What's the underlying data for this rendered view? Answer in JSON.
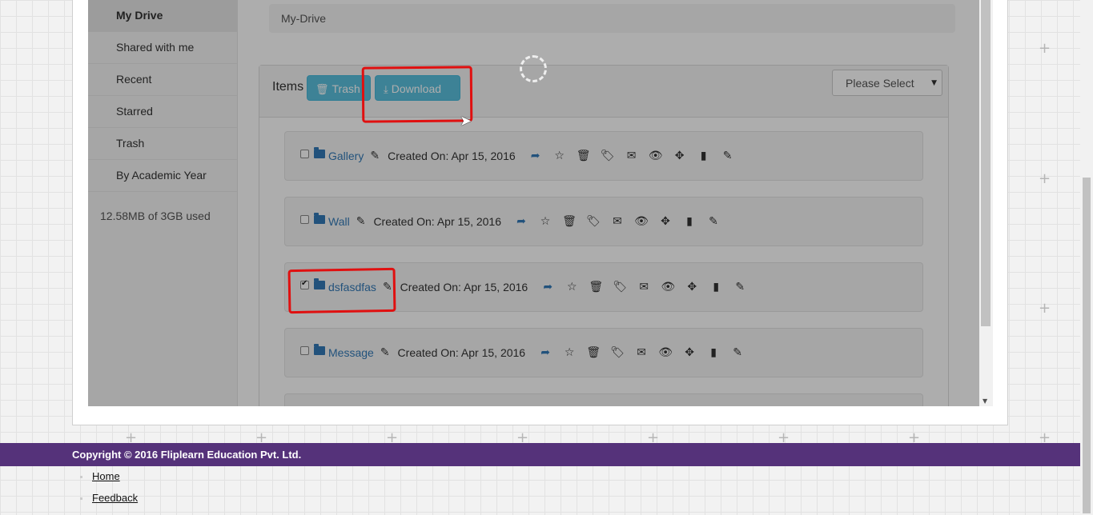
{
  "sidebar": {
    "items": [
      {
        "label": "My Drive"
      },
      {
        "label": "Shared with me"
      },
      {
        "label": "Recent"
      },
      {
        "label": "Starred"
      },
      {
        "label": "Trash"
      },
      {
        "label": "By Academic Year"
      }
    ],
    "active": "My Drive",
    "storage": "12.58MB of 3GB used"
  },
  "breadcrumb": "My-Drive",
  "panel": {
    "items_label": "Items",
    "trash_button": "Trash",
    "download_button": "Download",
    "select_value": "Please Select"
  },
  "rows": [
    {
      "name": "Gallery",
      "created": "Created On: Apr 15, 2016",
      "checked": false
    },
    {
      "name": "Wall",
      "created": "Created On: Apr 15, 2016",
      "checked": false
    },
    {
      "name": "dsfasdfas",
      "created": "Created On: Apr 15, 2016",
      "checked": true
    },
    {
      "name": "Message",
      "created": "Created On: Apr 15, 2016",
      "checked": false
    }
  ],
  "row_actions": [
    "share-icon",
    "star-icon",
    "trash-icon",
    "tags-icon",
    "envelope-icon",
    "eye-icon",
    "move-icon",
    "copy-icon",
    "edit-icon"
  ],
  "footer": {
    "copyright": "Copyright © 2016 Fliplearn Education Pvt. Ltd.",
    "links": [
      "Home",
      "Feedback"
    ]
  },
  "colors": {
    "footer_bg": "#55327a",
    "info_button": "#5bc0de",
    "link": "#337ab7",
    "annotation": "#e01010"
  }
}
